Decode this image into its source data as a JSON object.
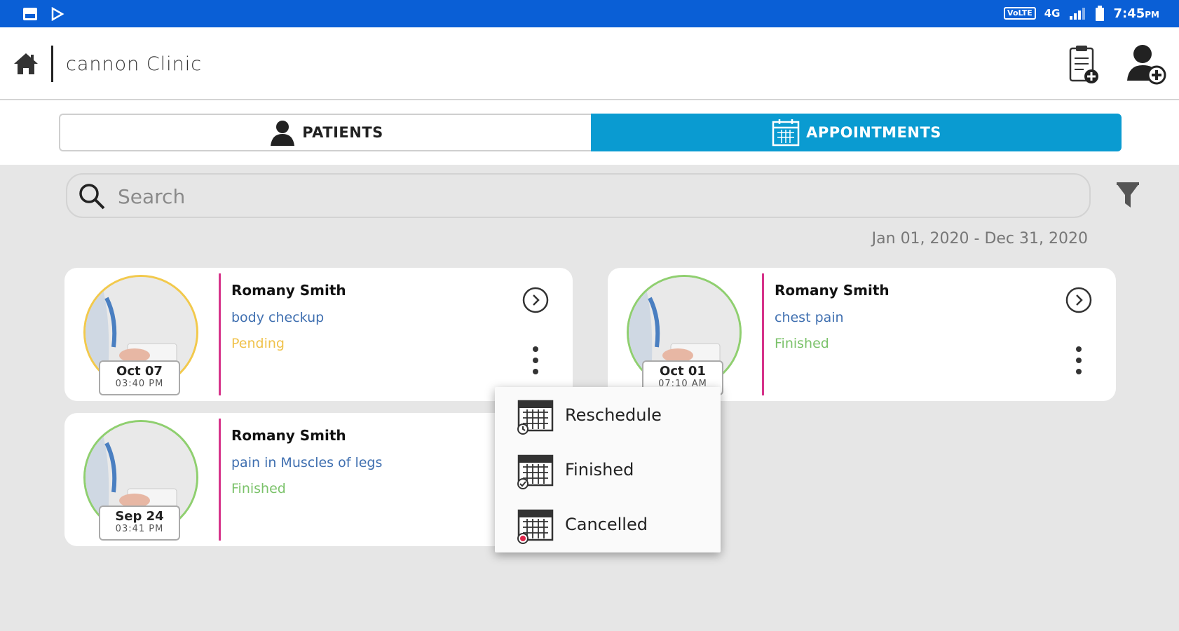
{
  "status_bar": {
    "net_badge": "VoLTE",
    "net_type": "4G",
    "time": "7:45",
    "meridiem": "PM"
  },
  "app_bar": {
    "title": "cannon Clinic"
  },
  "tabs": [
    {
      "label": "PATIENTS",
      "icon": "person-icon"
    },
    {
      "label": "APPOINTMENTS",
      "icon": "calendar-icon"
    }
  ],
  "search": {
    "placeholder": "Search",
    "value": ""
  },
  "date_range": "Jan 01, 2020 - Dec 31, 2020",
  "appointments": [
    {
      "name": "Romany Smith",
      "reason": "body checkup",
      "status": "Pending",
      "date": "Oct 07",
      "time": "03:40 PM"
    },
    {
      "name": "Romany Smith",
      "reason": "chest pain",
      "status": "Finished",
      "date": "Oct 01",
      "time": "07:10 AM"
    },
    {
      "name": "Romany Smith",
      "reason": "pain in Muscles of legs",
      "status": "Finished",
      "date": "Sep 24",
      "time": "03:41 PM"
    }
  ],
  "context_menu": {
    "items": [
      {
        "label": "Reschedule",
        "icon": "calendar-reschedule-icon"
      },
      {
        "label": "Finished",
        "icon": "calendar-check-icon"
      },
      {
        "label": "Cancelled",
        "icon": "calendar-cancel-icon"
      }
    ]
  },
  "colors": {
    "status_bar": "#0a5fd6",
    "tab_active": "#0a9bd1",
    "card_divider": "#d6338a",
    "reason_text": "#3f6fb0",
    "pending": "#f0c24b",
    "finished": "#7bc26a"
  }
}
